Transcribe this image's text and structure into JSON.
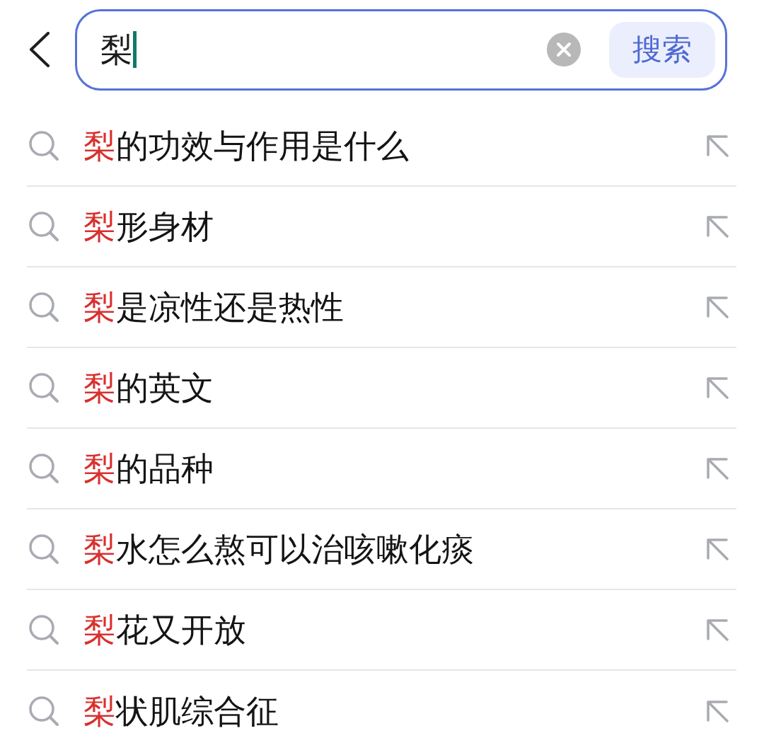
{
  "search_bar": {
    "focused": true,
    "value": "梨",
    "search_button": "搜索"
  },
  "suggestions": [
    {
      "match": "梨",
      "rest": "的功效与作用是什么"
    },
    {
      "match": "梨",
      "rest": "形身材"
    },
    {
      "match": "梨",
      "rest": "是凉性还是热性"
    },
    {
      "match": "梨",
      "rest": "的英文"
    },
    {
      "match": "梨",
      "rest": "的品种"
    },
    {
      "match": "梨",
      "rest": "水怎么熬可以治咳嗽化痰"
    },
    {
      "match": "梨",
      "rest": "花又开放"
    },
    {
      "match": "梨",
      "rest": "状肌综合征"
    }
  ]
}
